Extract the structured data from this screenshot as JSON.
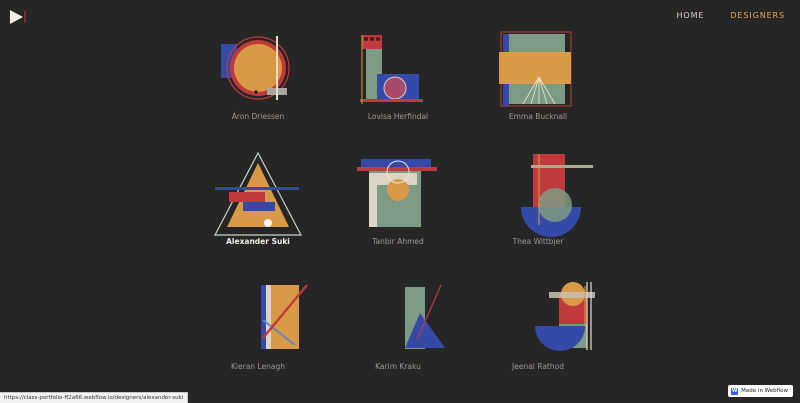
{
  "header": {
    "nav": [
      {
        "label": "HOME",
        "active": false
      },
      {
        "label": "DESIGNERS",
        "active": true
      }
    ],
    "accent_color": "#e8a553"
  },
  "designers": [
    {
      "name": "Áron Driessen",
      "selected": false
    },
    {
      "name": "Lovisa Herfindal",
      "selected": false
    },
    {
      "name": "Emma Bucknall",
      "selected": false
    },
    {
      "name": "Alexander Suki",
      "selected": true
    },
    {
      "name": "Tanbir Ahmed",
      "selected": false
    },
    {
      "name": "Thea Wittbjer",
      "selected": false
    },
    {
      "name": "Kieran Lenagh",
      "selected": false
    },
    {
      "name": "Karim Kraku",
      "selected": false
    },
    {
      "name": "Jeenal Rathod",
      "selected": false
    }
  ],
  "status_bar": {
    "url": "https://class-portfolio-ff2a66.webflow.io/designers/alexander-suki"
  },
  "badge": {
    "label": "Made in Webflow",
    "icon": "webflow-icon"
  },
  "palette": {
    "orange": "#d99a48",
    "red": "#c0393b",
    "blue": "#3449a8",
    "green": "#7d9a84",
    "cream": "#ddd5c3"
  }
}
